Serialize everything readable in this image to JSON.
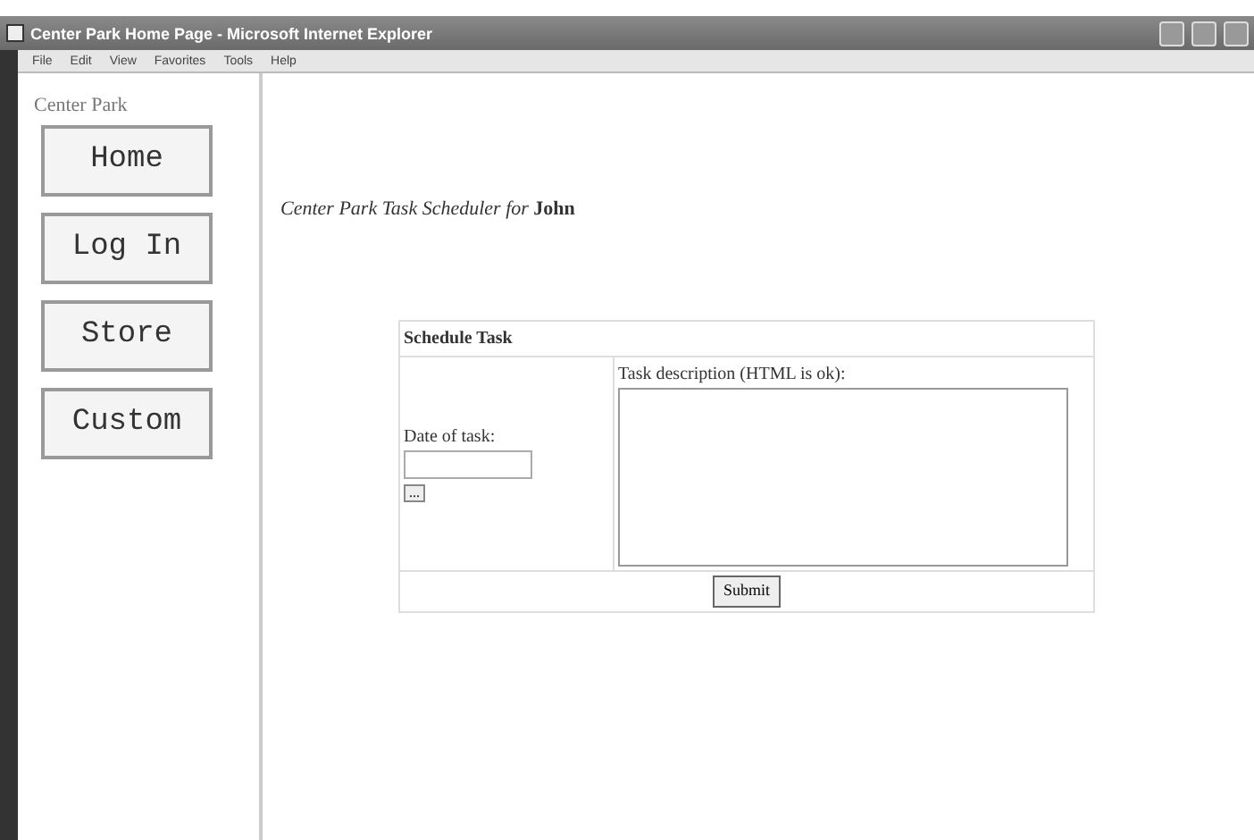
{
  "window": {
    "title": "Center Park Home Page - Microsoft Internet Explorer"
  },
  "menu": [
    "File",
    "Edit",
    "View",
    "Favorites",
    "Tools",
    "Help"
  ],
  "sidebar": {
    "site_name": "Center Park",
    "buttons": [
      "Home",
      "Log In",
      "Store",
      "Custom"
    ]
  },
  "heading": "*Center Park Task Scheduler for* **John**",
  "form": {
    "title": "Schedule Task",
    "date_label": "Date of task:",
    "date_picker": "...",
    "description_label": "Task description (HTML is ok):",
    "submit": "Submit"
  }
}
